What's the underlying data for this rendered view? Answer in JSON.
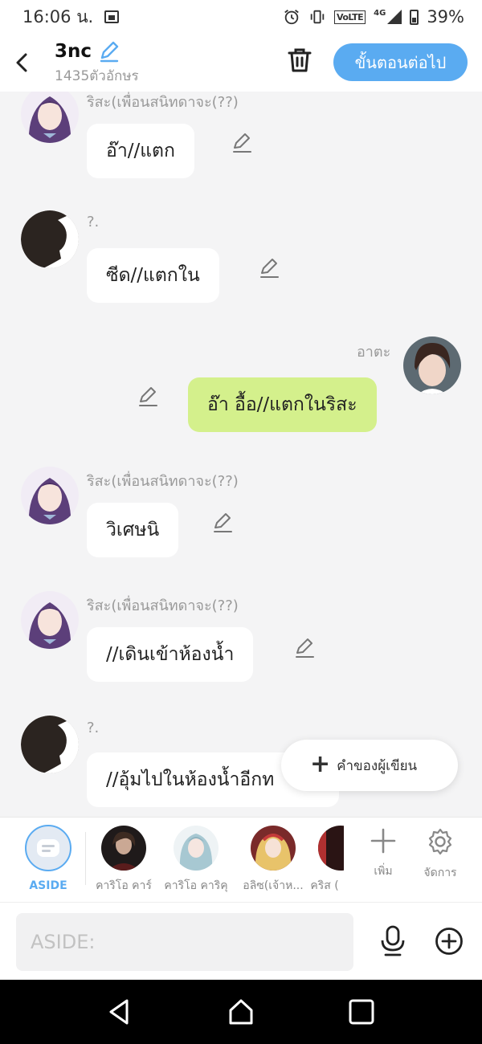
{
  "status": {
    "time": "16:06 น.",
    "volte": "VoLTE",
    "network": "4G",
    "battery": "39%"
  },
  "header": {
    "title": "3nc",
    "char_count": "1435ตัวอักษร",
    "next_label": "ขั้นตอนต่อไป"
  },
  "messages": [
    {
      "sender": "ริสะ(เพื่อนสนิทดาจะ(??)",
      "text": "อ๊า//แตก",
      "side": "left",
      "avatar": "risa"
    },
    {
      "sender": "?.",
      "text": "ซีด//แตกใน",
      "side": "left",
      "avatar": "silhouette"
    },
    {
      "sender": "อาตะ",
      "text": "อ๊า อื้อ//แตกในริสะ",
      "side": "right",
      "avatar": "ata"
    },
    {
      "sender": "ริสะ(เพื่อนสนิทดาจะ(??)",
      "text": "วิเศษนิ",
      "side": "left",
      "avatar": "risa"
    },
    {
      "sender": "ริสะ(เพื่อนสนิทดาจะ(??)",
      "text": "//เดินเข้าห้องน้ำ",
      "side": "left",
      "avatar": "risa"
    },
    {
      "sender": "?.",
      "text": "//อุ้มไปในห้องน้ำอีกท",
      "side": "left",
      "avatar": "silhouette"
    }
  ],
  "fab": {
    "label": "คำของผู้เขียน"
  },
  "characters": {
    "aside_label": "ASIDE",
    "items": [
      {
        "name": "คาริโอ คาร์"
      },
      {
        "name": "คาริโอ คาริคุ"
      },
      {
        "name": "อลิซ(เจ้าห..."
      },
      {
        "name": "คริส ("
      }
    ],
    "add_label": "เพิ่ม",
    "manage_label": "จัดการ"
  },
  "input": {
    "placeholder": "ASIDE:"
  },
  "colors": {
    "accent": "#5aabf1",
    "user_bubble": "#d4f08c",
    "bubble": "#ffffff",
    "background": "#f4f4f5"
  },
  "icons": [
    "back-icon",
    "edit-pencil-icon",
    "trash-icon",
    "plus-icon",
    "settings-gear-icon",
    "microphone-icon",
    "add-circle-icon",
    "nav-back-icon",
    "nav-home-icon",
    "nav-recents-icon"
  ]
}
